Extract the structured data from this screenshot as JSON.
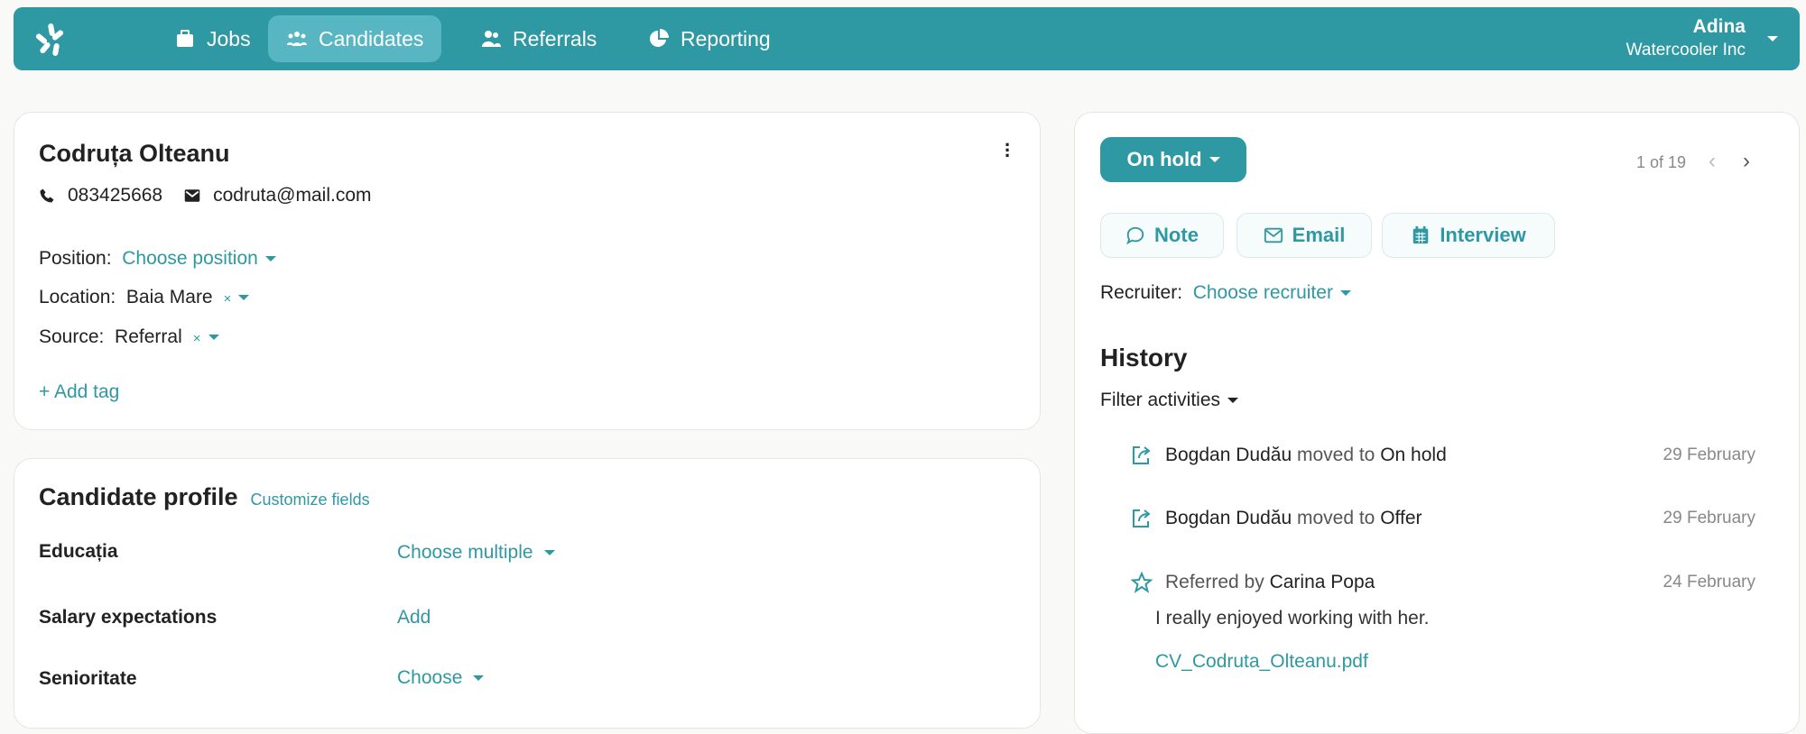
{
  "nav": {
    "items": [
      {
        "label": "Jobs",
        "icon": "briefcase-icon"
      },
      {
        "label": "Candidates",
        "icon": "users-icon",
        "active": true
      },
      {
        "label": "Referrals",
        "icon": "user-friends-icon"
      },
      {
        "label": "Reporting",
        "icon": "pie-chart-icon"
      }
    ],
    "user": {
      "name": "Adina",
      "company": "Watercooler Inc"
    }
  },
  "colors": {
    "brand": "#2e98a3",
    "active_tab": "#57b6c2"
  },
  "candidate": {
    "name": "Codruța Olteanu",
    "phone": "083425668",
    "email": "codruta@mail.com",
    "position_label": "Position:",
    "position_value": "Choose position",
    "location_label": "Location:",
    "location_value": "Baia Mare",
    "source_label": "Source:",
    "source_value": "Referral",
    "remove_symbol": "×",
    "add_tag": "+ Add tag"
  },
  "profile": {
    "title": "Candidate profile",
    "customize": "Customize fields",
    "fields": [
      {
        "label": "Educația",
        "value": "Choose multiple"
      },
      {
        "label": "Salary expectations",
        "value": "Add"
      },
      {
        "label": "Senioritate",
        "value": "Choose"
      }
    ]
  },
  "side": {
    "status": "On hold",
    "pager": "1 of 19",
    "actions": [
      "Note",
      "Email",
      "Interview"
    ],
    "recruiter_label": "Recruiter:",
    "recruiter_value": "Choose recruiter",
    "history_title": "History",
    "filter": "Filter activities",
    "history": [
      {
        "actor": "Bogdan Dudău",
        "verb": "moved to",
        "target": "On hold",
        "date": "29 February"
      },
      {
        "actor": "Bogdan Dudău",
        "verb": "moved to",
        "target": "Offer",
        "date": "29 February"
      },
      {
        "verb": "Referred by",
        "actor": "Carina Popa",
        "date": "24 February",
        "comment": "I really enjoyed working with her.",
        "attachment": "CV_Codruta_Olteanu.pdf"
      }
    ]
  }
}
